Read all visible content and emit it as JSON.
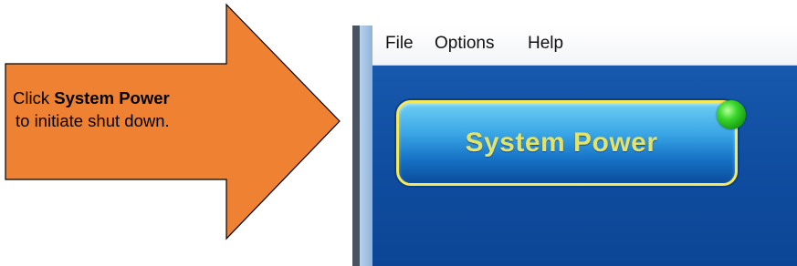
{
  "callout": {
    "prefix": "Click",
    "target": "System Power",
    "suffix": "to initiate shut down.",
    "arrow_color": "#ef8132",
    "arrow_outline": "#000000"
  },
  "menubar": {
    "items": [
      "File",
      "Options",
      "Help"
    ]
  },
  "main": {
    "power_button_label": "System Power",
    "status_led": "green-status-led",
    "background_color": "#0e4b9e",
    "button_border_color": "#f3e95a",
    "label_color": "#e3e36a"
  }
}
